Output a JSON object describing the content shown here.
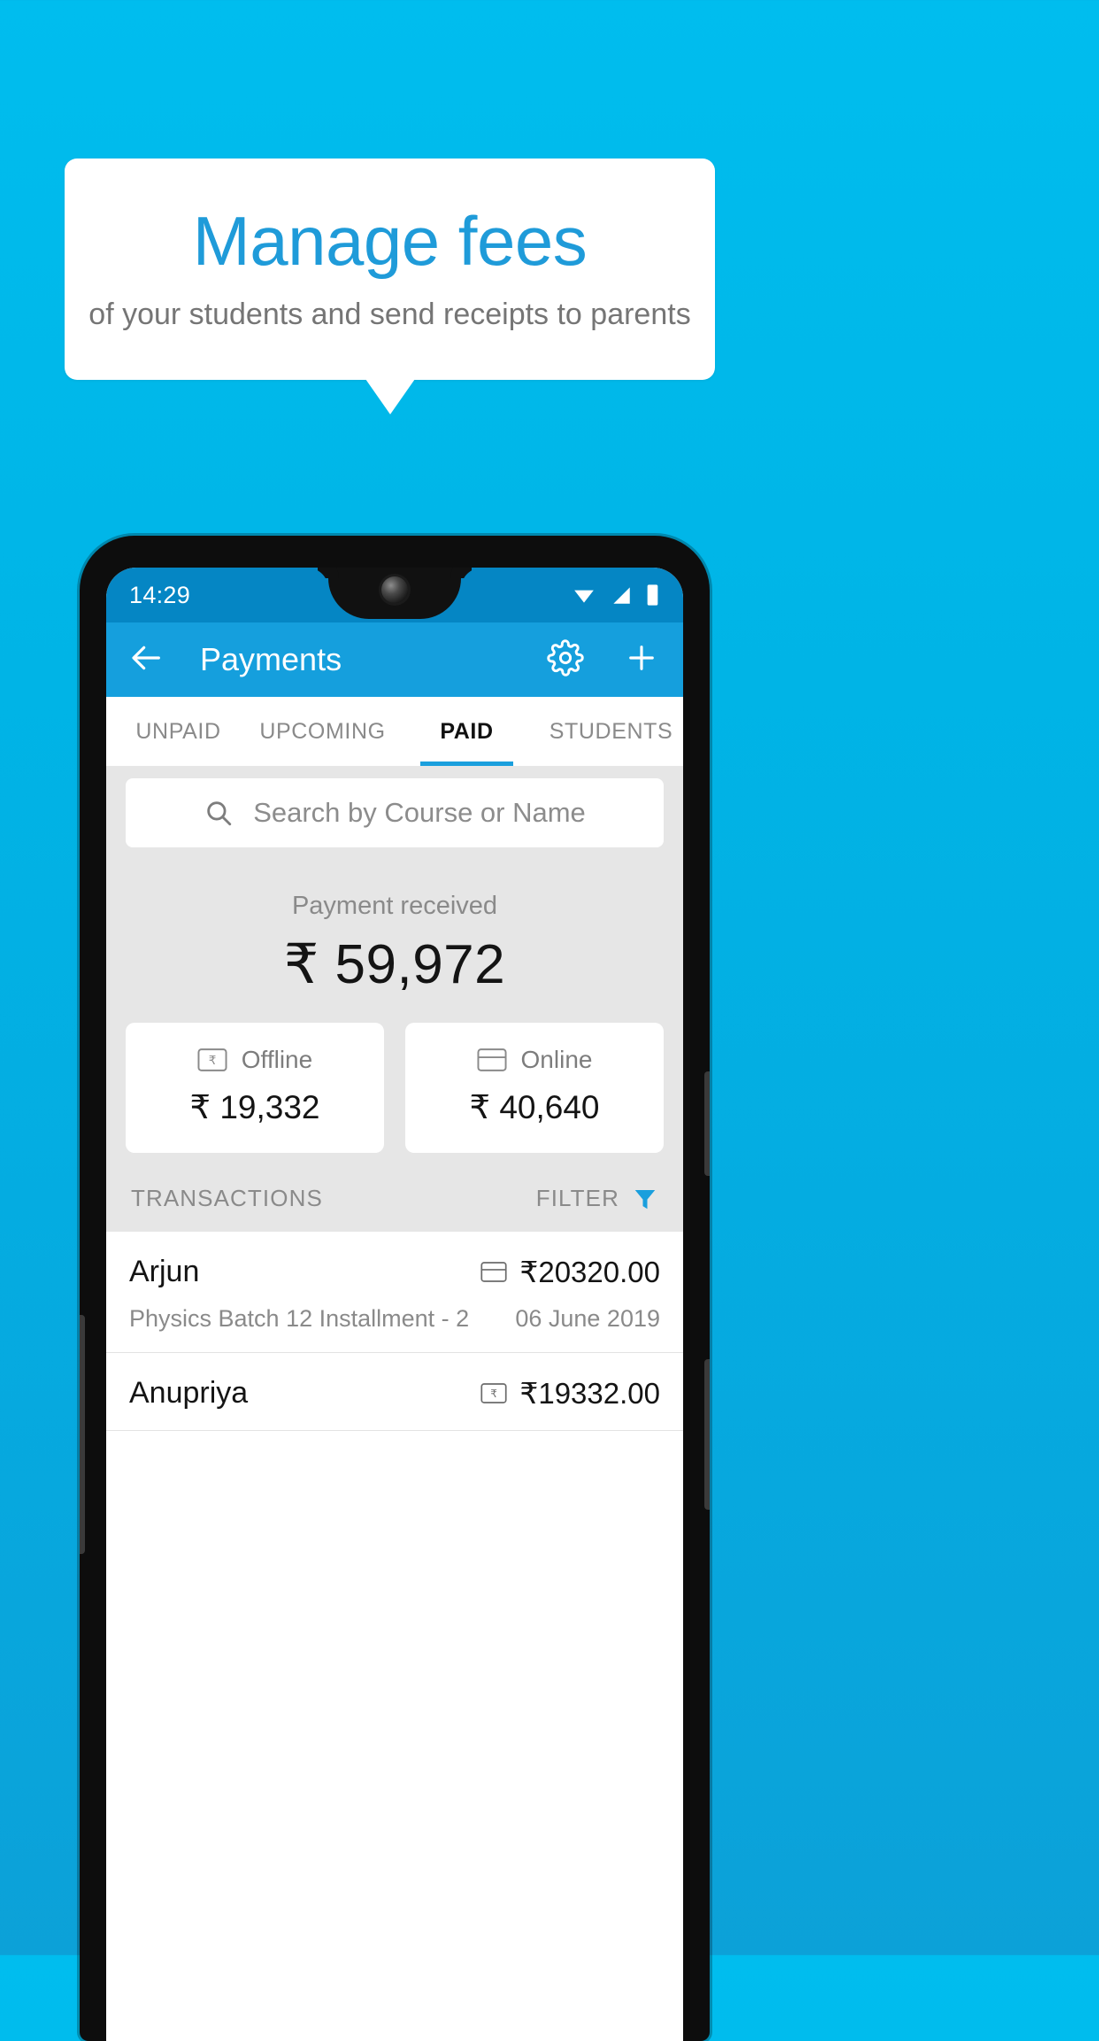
{
  "promo": {
    "title": "Manage fees",
    "subtitle": "of your students and send receipts to parents",
    "accent_color": "#1F9BD9",
    "background_color": "#00BDEE"
  },
  "phone": {
    "status_bar": {
      "time": "14:29",
      "icons": [
        "wifi-icon",
        "signal-icon",
        "battery-icon"
      ]
    },
    "app_bar": {
      "back_icon": "arrow-left-icon",
      "title": "Payments",
      "settings_icon": "gear-icon",
      "add_icon": "plus-icon",
      "color": "#159FDD"
    },
    "tabs": [
      {
        "label": "UNPAID",
        "active": false
      },
      {
        "label": "UPCOMING",
        "active": false
      },
      {
        "label": "PAID",
        "active": true
      },
      {
        "label": "STUDENTS",
        "active": false
      }
    ],
    "search": {
      "icon": "search-icon",
      "placeholder": "Search by Course or Name"
    },
    "summary": {
      "label": "Payment received",
      "amount": "₹ 59,972"
    },
    "method_cards": [
      {
        "icon": "banknote-rupee-icon",
        "title": "Offline",
        "amount": "₹ 19,332"
      },
      {
        "icon": "credit-card-icon",
        "title": "Online",
        "amount": "₹ 40,640"
      }
    ],
    "transactions_header": {
      "label": "TRANSACTIONS",
      "filter_label": "FILTER",
      "filter_icon": "funnel-icon",
      "filter_color": "#1A9FDD"
    },
    "transactions": [
      {
        "name": "Arjun",
        "method_icon": "credit-card-icon",
        "amount": "₹20320.00",
        "description": "Physics Batch 12 Installment - 2",
        "date": "06 June 2019"
      },
      {
        "name": "Anupriya",
        "method_icon": "banknote-rupee-icon",
        "amount": "₹19332.00",
        "description": "",
        "date": ""
      }
    ]
  }
}
